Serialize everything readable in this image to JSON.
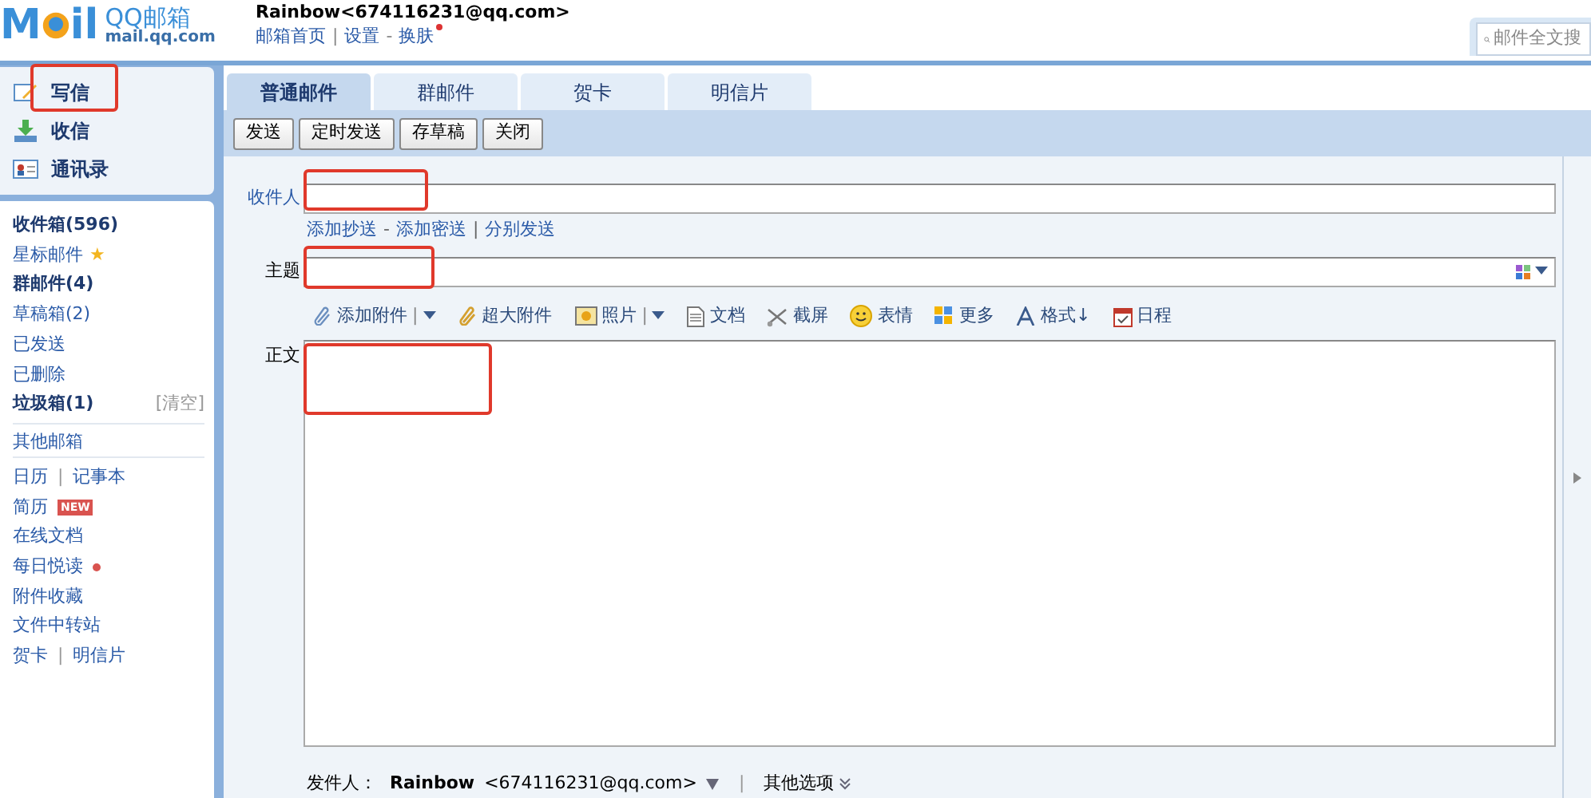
{
  "header": {
    "logo": {
      "letters_left": "M",
      "letters_right": "il",
      "brand": "QQ邮箱",
      "domain": "mail.qq.com"
    },
    "account": "Rainbow<674116231@qq.com>",
    "links": [
      {
        "label": "邮箱首页",
        "separator": "|",
        "dot": false
      },
      {
        "label": "设置",
        "separator": "-",
        "dot": false
      },
      {
        "label": "换肤",
        "dot": true
      }
    ],
    "search": {
      "placeholder": "邮件全文搜"
    }
  },
  "sidebar": {
    "actions": [
      {
        "label": "写信"
      },
      {
        "label": "收信"
      },
      {
        "label": "通讯录"
      }
    ],
    "folders": [
      {
        "label": "收件箱(596)",
        "bold": true
      },
      {
        "label": "星标邮件",
        "bold": false,
        "star": "★"
      },
      {
        "label": "群邮件(4)",
        "bold": true
      },
      {
        "label": "草稿箱(2)",
        "bold": false
      },
      {
        "label": "已发送",
        "bold": false
      },
      {
        "label": "已删除",
        "bold": false
      },
      {
        "label": "垃圾箱(1)",
        "bold": true,
        "action": "[清空]"
      }
    ],
    "other": "其他邮箱",
    "apps": [
      {
        "items": [
          {
            "label": "日历",
            "separator": "|"
          },
          {
            "label": "记事本"
          }
        ]
      },
      {
        "items": [
          {
            "label": "简历"
          }
        ],
        "badge": "NEW"
      },
      {
        "items": [
          {
            "label": "在线文档"
          }
        ]
      },
      {
        "items": [
          {
            "label": "每日悦读"
          }
        ],
        "dot": true
      },
      {
        "items": [
          {
            "label": "附件收藏"
          }
        ]
      },
      {
        "items": [
          {
            "label": "文件中转站"
          }
        ]
      },
      {
        "items": [
          {
            "label": "贺卡",
            "separator": "|"
          },
          {
            "label": "明信片"
          }
        ]
      }
    ]
  },
  "tabs": [
    {
      "label": "普通邮件",
      "selected": true
    },
    {
      "label": "群邮件",
      "selected": false
    },
    {
      "label": "贺卡",
      "selected": false
    },
    {
      "label": "明信片",
      "selected": false
    }
  ],
  "buttons": [
    "发送",
    "定时发送",
    "存草稿",
    "关闭"
  ],
  "form": {
    "to_label": "收件人",
    "cc_links": [
      {
        "label": "添加抄送",
        "separator": "-"
      },
      {
        "label": "添加密送",
        "separator": "|"
      },
      {
        "label": "分别发送"
      }
    ],
    "subject_label": "主题",
    "body_label": "正文",
    "tools": [
      {
        "label": "添加附件",
        "separator": "|"
      },
      {
        "label": "超大附件"
      },
      {
        "label": "照片",
        "separator": "|"
      },
      {
        "label": "文档"
      },
      {
        "label": "截屏"
      },
      {
        "label": "表情"
      },
      {
        "label": "更多"
      },
      {
        "label": "格式↓"
      },
      {
        "label": "日程"
      }
    ]
  },
  "footer": {
    "sender_label": "发件人：",
    "sender_name": "Rainbow",
    "sender_address": "<674116231@qq.com>",
    "divider": "|",
    "more": "其他选项"
  }
}
